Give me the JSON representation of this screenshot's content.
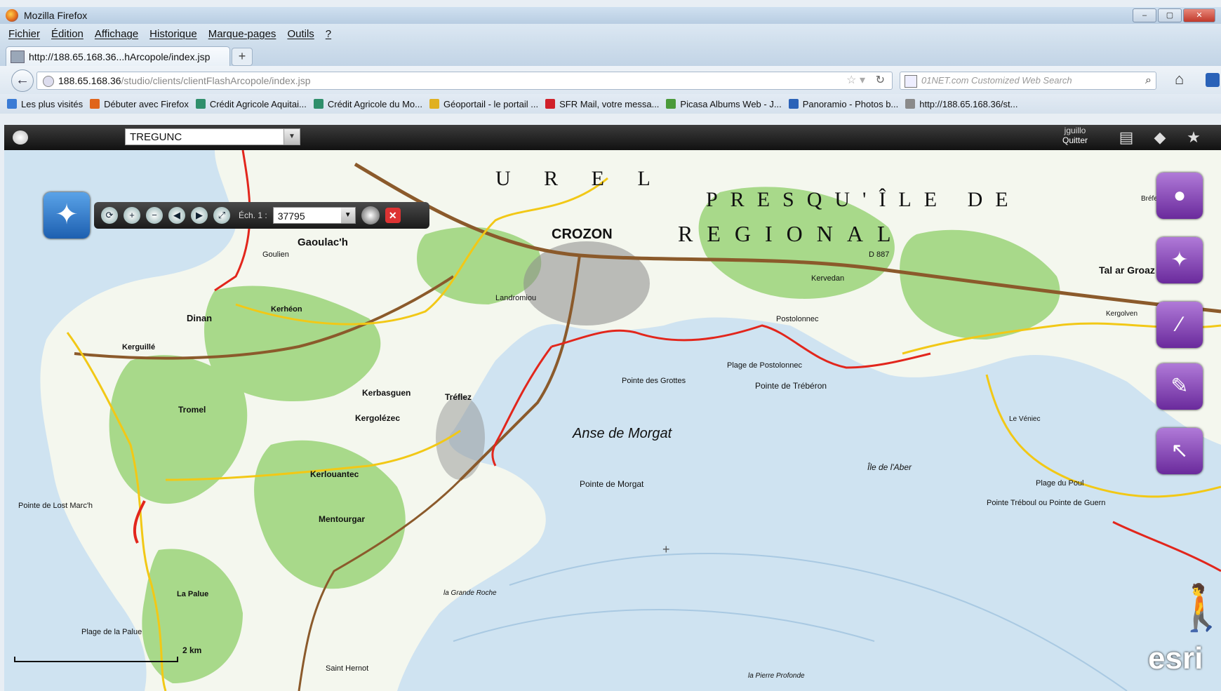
{
  "window": {
    "title": "Mozilla Firefox",
    "controls": [
      "–",
      "▢",
      "✕"
    ]
  },
  "menu": [
    "Fichier",
    "Édition",
    "Affichage",
    "Historique",
    "Marque-pages",
    "Outils",
    "?"
  ],
  "tab": {
    "label": "http://188.65.168.36...hArcopole/index.jsp",
    "new_tab": "+"
  },
  "nav": {
    "url_host": "188.65.168.36",
    "url_path": "/studio/clients/clientFlashArcopole/index.jsp",
    "search_placeholder": "01NET.com Customized Web Search"
  },
  "bookmarks": [
    {
      "label": "Les plus visités",
      "color": "#3a7bd5"
    },
    {
      "label": "Débuter avec Firefox",
      "color": "#e0641a"
    },
    {
      "label": "Crédit Agricole Aquitai...",
      "color": "#2f8f6b"
    },
    {
      "label": "Crédit Agricole du Mo...",
      "color": "#2f8f6b"
    },
    {
      "label": "Géoportail - le portail ...",
      "color": "#e0b020"
    },
    {
      "label": "SFR Mail, votre messa...",
      "color": "#d0202a"
    },
    {
      "label": "Picasa Albums Web - J...",
      "color": "#4a9a3a"
    },
    {
      "label": "Panoramio - Photos b...",
      "color": "#2a62b8"
    },
    {
      "label": "http://188.65.168.36/st...",
      "color": "#8a8a8a"
    }
  ],
  "app": {
    "search_value": "TREGUNC",
    "user": "jguillo",
    "quit_label": "Quitter",
    "scale_label": "Éch. 1 :",
    "scale_value": "37795",
    "scalebar_label": "2 km",
    "logo": "esri"
  },
  "map_labels": [
    {
      "text": "CROZON"
    },
    {
      "text": "Anse  de  Morgat"
    },
    {
      "text": "Pointe de Morgat"
    },
    {
      "text": "Pointe des Grottes"
    },
    {
      "text": "Pointe de Trébéron"
    },
    {
      "text": "Plage de Postolonnec"
    },
    {
      "text": "Île de l'Aber"
    },
    {
      "text": "Pointe Tréboul ou Pointe de Guern"
    },
    {
      "text": "Plage du Poul"
    },
    {
      "text": "Pointe de Lost Marc'h"
    },
    {
      "text": "Plage de la Palue"
    },
    {
      "text": "Dinan"
    },
    {
      "text": "Kergolézec"
    },
    {
      "text": "Kerbasguen"
    },
    {
      "text": "Tréflez"
    },
    {
      "text": "Kerlouantec"
    },
    {
      "text": "Mentourgar"
    },
    {
      "text": "Bréfezen"
    },
    {
      "text": "Tromel"
    },
    {
      "text": "Gaoulac'h"
    },
    {
      "text": "Landromiou"
    },
    {
      "text": "Tal ar Groaz"
    },
    {
      "text": "Kerhéon"
    },
    {
      "text": "Postolonnec"
    },
    {
      "text": "Kerguillé"
    },
    {
      "text": "Kervedan"
    },
    {
      "text": "Goulien"
    },
    {
      "text": "La Palue"
    },
    {
      "text": "Saint Hernot"
    },
    {
      "text": "Le Véniec"
    },
    {
      "text": "la Pierre Profonde"
    },
    {
      "text": "PRESQU'ÎLE  DE"
    },
    {
      "text": "REGIONAL"
    },
    {
      "text": "U R E L"
    },
    {
      "text": "D 887"
    },
    {
      "text": "la Grande Roche"
    },
    {
      "text": "Kergolven"
    }
  ],
  "colors": {
    "sea": "#cfe3f1",
    "land": "#f4f7ee",
    "green": "#9ed47a",
    "road_yellow": "#f2c816",
    "road_red": "#e2261c",
    "purple": "#8a44c0"
  }
}
